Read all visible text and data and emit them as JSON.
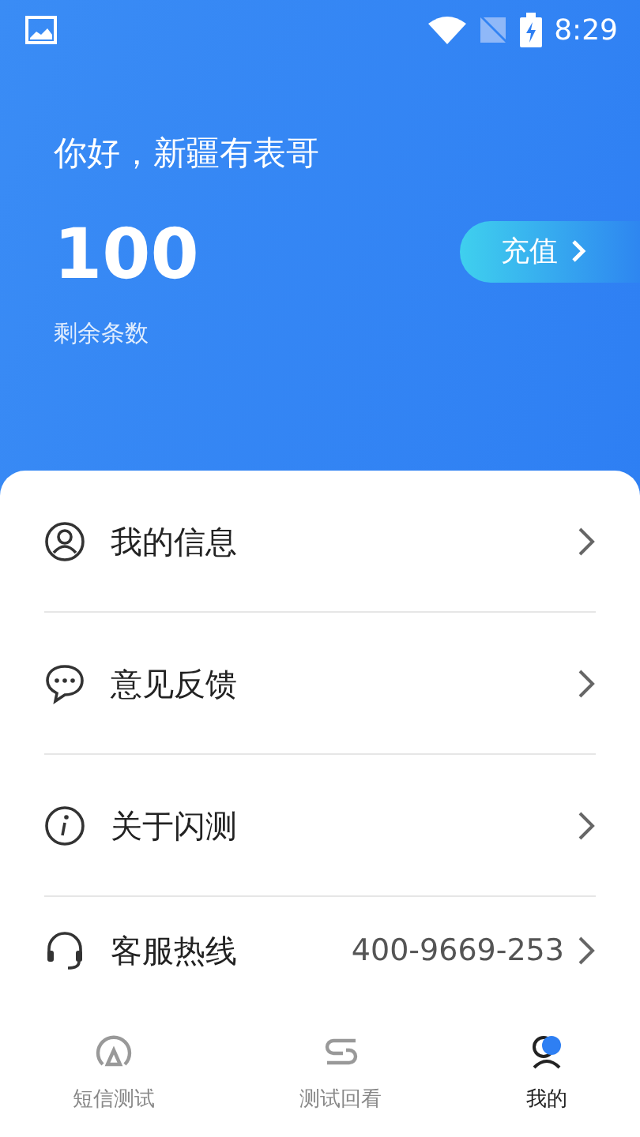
{
  "status_bar": {
    "time": "8:29"
  },
  "header": {
    "greeting": "你好，新疆有表哥",
    "count": "100",
    "count_label": "剩余条数",
    "recharge_button": "充值"
  },
  "menu": [
    {
      "label": "我的信息"
    },
    {
      "label": "意见反馈"
    },
    {
      "label": "关于闪测"
    },
    {
      "label": "客服热线",
      "value": "400-9669-253"
    }
  ],
  "tabs": [
    {
      "label": "短信测试",
      "selected": false
    },
    {
      "label": "测试回看",
      "selected": false
    },
    {
      "label": "我的",
      "selected": true
    }
  ]
}
